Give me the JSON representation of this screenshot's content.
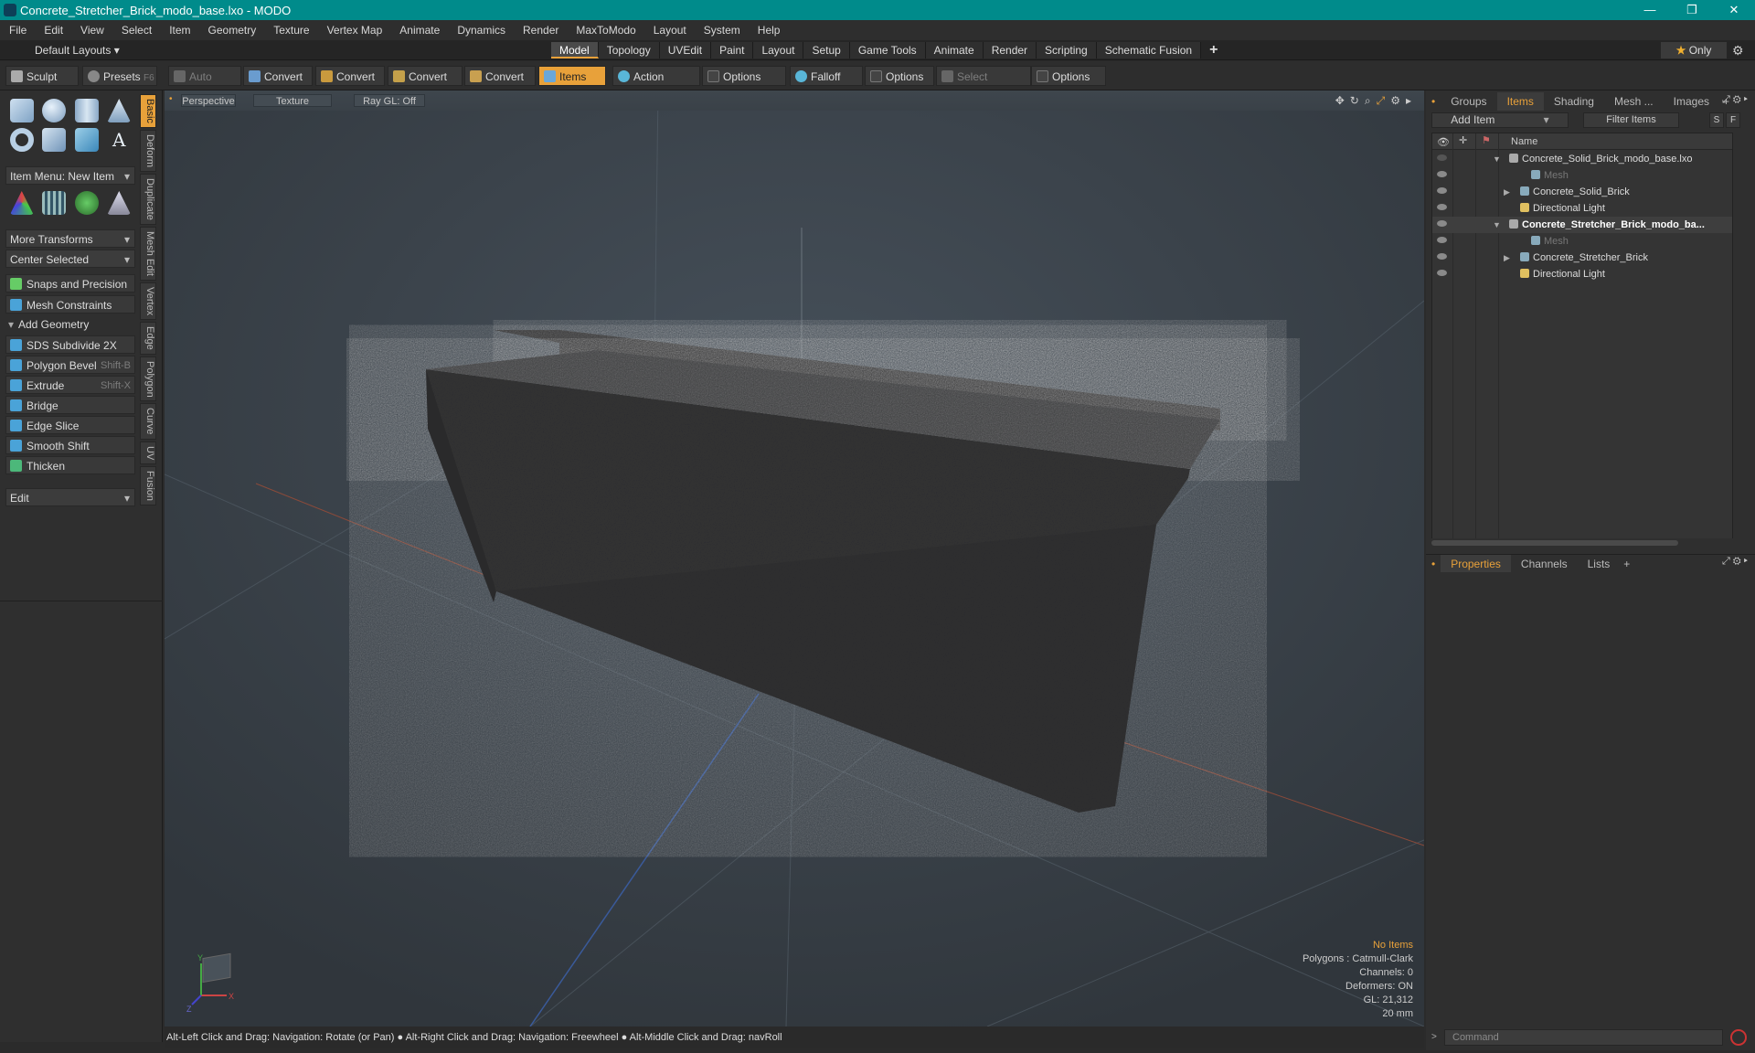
{
  "window": {
    "title": "Concrete_Stretcher_Brick_modo_base.lxo - MODO",
    "min": "—",
    "max": "❐",
    "close": "✕"
  },
  "menu": [
    "File",
    "Edit",
    "View",
    "Select",
    "Item",
    "Geometry",
    "Texture",
    "Vertex Map",
    "Animate",
    "Dynamics",
    "Render",
    "MaxToModo",
    "Layout",
    "System",
    "Help"
  ],
  "layoutbar": {
    "default_layouts": "Default Layouts ▾",
    "tabs": [
      "Model",
      "Topology",
      "UVEdit",
      "Paint",
      "Layout",
      "Setup",
      "Game Tools",
      "Animate",
      "Render",
      "Scripting",
      "Schematic Fusion"
    ],
    "plus": "+",
    "only": "Only",
    "star": "★",
    "gear": "⚙"
  },
  "toolbar": {
    "sculpt": "Sculpt",
    "presets": "Presets",
    "presets_key": "F6",
    "auto_select": "Auto Select",
    "convert1": "Convert",
    "convert2": "Convert",
    "convert3": "Convert",
    "convert4": "Convert",
    "items": "Items",
    "action_center": "Action Center",
    "options1": "Options",
    "falloff": "Falloff",
    "options2": "Options",
    "select_through": "Select Through",
    "options3": "Options"
  },
  "left": {
    "item_menu": "Item Menu: New Item",
    "more_transforms": "More Transforms",
    "center_selected": "Center Selected",
    "snaps": "Snaps and Precision",
    "mesh_constraints": "Mesh Constraints",
    "add_geometry": "Add Geometry",
    "tools": [
      {
        "label": "SDS Subdivide 2X",
        "key": ""
      },
      {
        "label": "Polygon Bevel",
        "key": "Shift-B"
      },
      {
        "label": "Extrude",
        "key": "Shift-X"
      },
      {
        "label": "Bridge",
        "key": ""
      },
      {
        "label": "Edge Slice",
        "key": ""
      },
      {
        "label": "Smooth Shift",
        "key": ""
      },
      {
        "label": "Thicken",
        "key": ""
      }
    ],
    "edit": "Edit",
    "vtabs": [
      "Basic",
      "Deform",
      "Duplicate",
      "Mesh Edit",
      "Vertex",
      "Edge",
      "Polygon",
      "Curve",
      "UV",
      "Fusion"
    ]
  },
  "viewport": {
    "view": "Perspective",
    "shading": "Texture",
    "raygl": "Ray GL: Off",
    "info": {
      "items": "No Items",
      "polygons": "Polygons : Catmull-Clark",
      "channels": "Channels: 0",
      "deformers": "Deformers: ON",
      "gl": "GL: 21,312",
      "scale": "20 mm"
    },
    "axis_x": "X",
    "axis_y": "Y",
    "axis_z": "Z"
  },
  "status": "Alt-Left Click and Drag: Navigation: Rotate (or Pan) ● Alt-Right Click and Drag: Navigation: Freewheel ● Alt-Middle Click and Drag: navRoll",
  "right": {
    "tabs": [
      "Groups",
      "Items",
      "Shading",
      "Mesh ...",
      "Images"
    ],
    "plus": "+",
    "add_item": "Add Item",
    "filter": "Filter Items",
    "s": "S",
    "f": "F",
    "col_name": "Name",
    "tree": [
      {
        "label": "Concrete_Solid_Brick_modo_base.lxo",
        "indent": 0,
        "exp": "▼",
        "bold": false,
        "dim": false,
        "eye": false
      },
      {
        "label": "Mesh",
        "indent": 2,
        "exp": "",
        "bold": false,
        "dim": true,
        "eye": true
      },
      {
        "label": "Concrete_Solid_Brick",
        "indent": 1,
        "exp": "▶",
        "bold": false,
        "dim": false,
        "eye": true
      },
      {
        "label": "Directional Light",
        "indent": 1,
        "exp": "",
        "bold": false,
        "dim": false,
        "eye": true
      },
      {
        "label": "Concrete_Stretcher_Brick_modo_ba...",
        "indent": 0,
        "exp": "▼",
        "bold": true,
        "dim": false,
        "eye": true
      },
      {
        "label": "Mesh",
        "indent": 2,
        "exp": "",
        "bold": false,
        "dim": true,
        "eye": true
      },
      {
        "label": "Concrete_Stretcher_Brick",
        "indent": 1,
        "exp": "▶",
        "bold": false,
        "dim": false,
        "eye": true
      },
      {
        "label": "Directional Light",
        "indent": 1,
        "exp": "",
        "bold": false,
        "dim": false,
        "eye": true
      }
    ],
    "ptabs": [
      "Properties",
      "Channels",
      "Lists"
    ],
    "command": "Command"
  }
}
